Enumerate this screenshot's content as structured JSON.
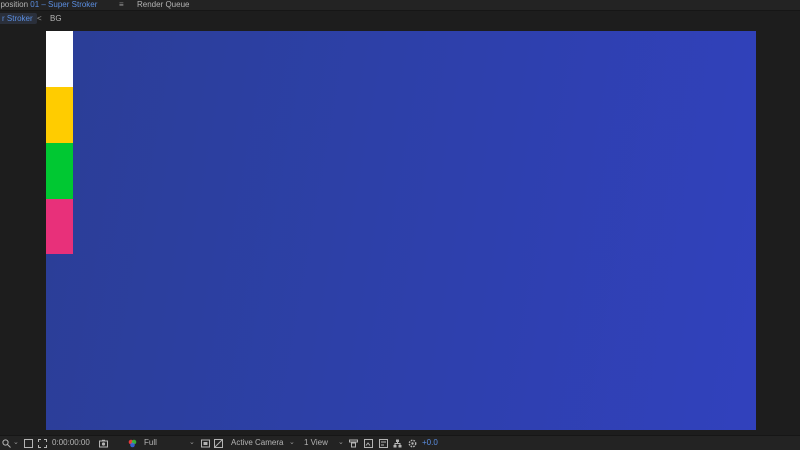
{
  "tabs": {
    "composition_prefix": "nposition",
    "composition_name": "01 – Super Stroker",
    "menu_glyph": "≡",
    "render_queue": "Render Queue"
  },
  "breadcrumb": {
    "active": "r Stroker",
    "separator": "<",
    "child": "BG"
  },
  "canvas": {
    "background": "#2d40a8",
    "swatches": [
      {
        "name": "white",
        "color": "#ffffff"
      },
      {
        "name": "yellow",
        "color": "#ffcc00"
      },
      {
        "name": "green",
        "color": "#00c832"
      },
      {
        "name": "pink",
        "color": "#e8307a"
      }
    ]
  },
  "toolbar": {
    "timecode": "0:00:00:00",
    "resolution": "Full",
    "camera": "Active Camera",
    "views": "1 View",
    "exposure": "+0.0",
    "icons": [
      "magnify-icon",
      "region-icon",
      "camera-snapshot-icon",
      "color-channel-icon",
      "grid-icon",
      "transparency-icon",
      "fast-preview-icon",
      "flowchart-icon",
      "exposure-reset-icon"
    ]
  }
}
